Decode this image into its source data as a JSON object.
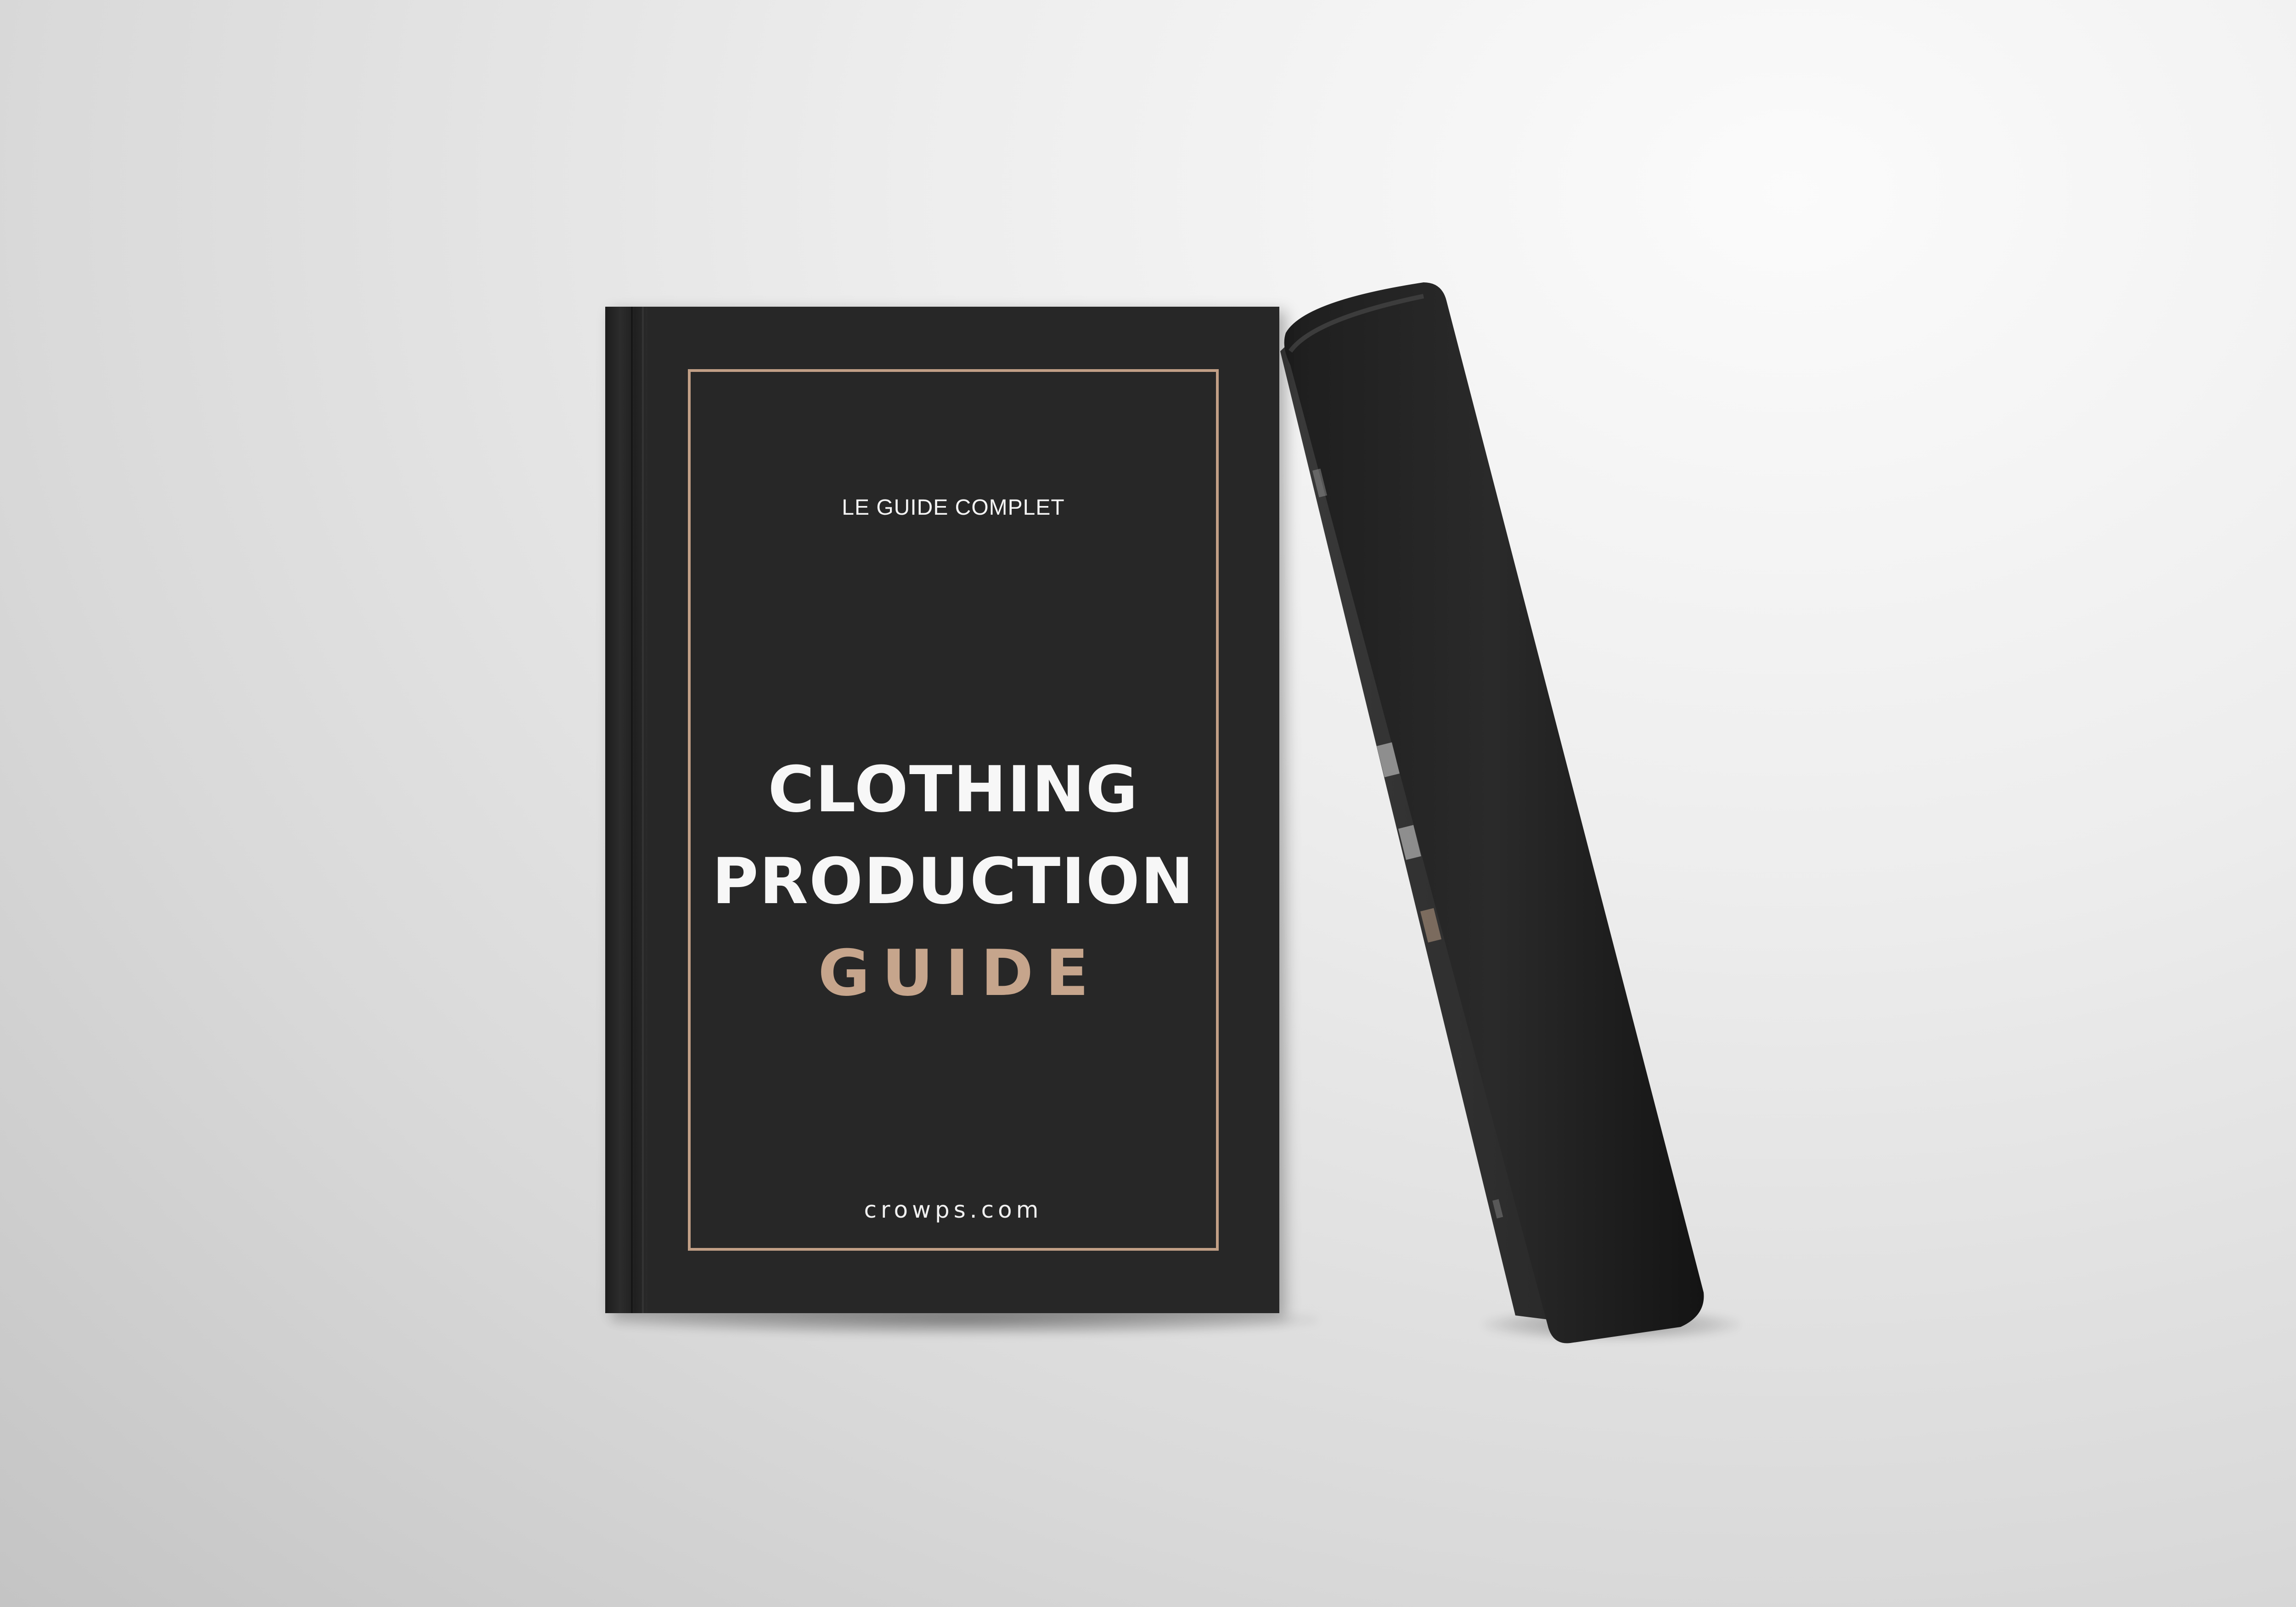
{
  "book": {
    "kicker": "LE GUIDE COMPLET",
    "title_line_1": "CLOTHING",
    "title_line_2": "PRODUCTION",
    "title_accent": "GUIDE",
    "website": "crowps.com"
  },
  "colors": {
    "cover": "#272727",
    "accent": "#c6a58c",
    "frame": "#c19f86",
    "text": "#f7f7f7"
  }
}
